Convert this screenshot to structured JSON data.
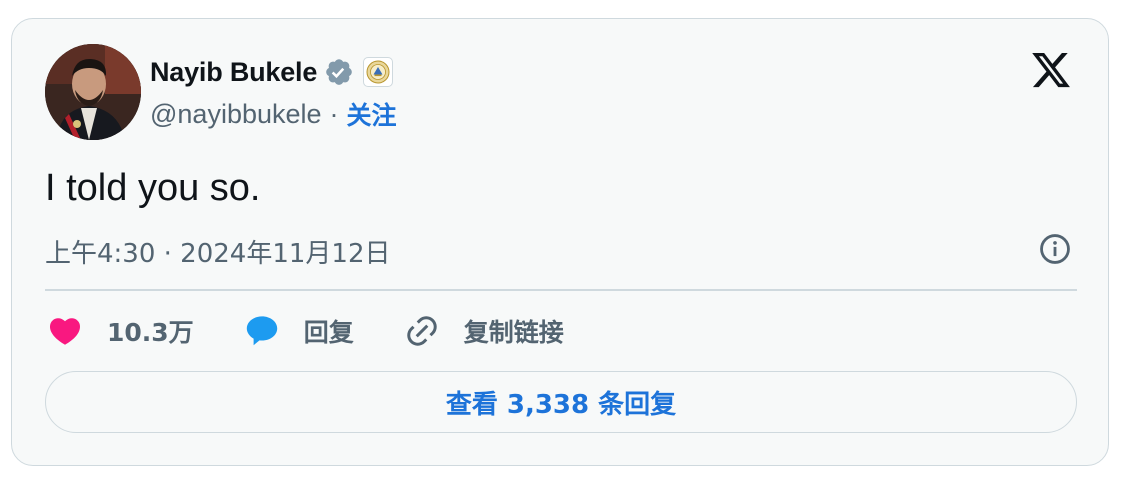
{
  "author": {
    "name": "Nayib Bukele",
    "handle": "@nayibbukele",
    "separator": "·",
    "follow_label": "关注",
    "verified_icon": "verified-badge-icon",
    "affiliation_icon": "government-seal-icon"
  },
  "tweet": {
    "text": "I told you so.",
    "timestamp": "上午4:30 · 2024年11月12日"
  },
  "actions": {
    "like_count": "10.3万",
    "reply_label": "回复",
    "copy_link_label": "复制链接"
  },
  "replies_button_label": "查看 3,338 条回复",
  "colors": {
    "accent": "#1d73d9",
    "like": "#f91880",
    "reply": "#1d9bf0",
    "muted": "#536471",
    "text": "#0f1419",
    "border": "#cfd9de",
    "background": "#f7f9f9"
  }
}
